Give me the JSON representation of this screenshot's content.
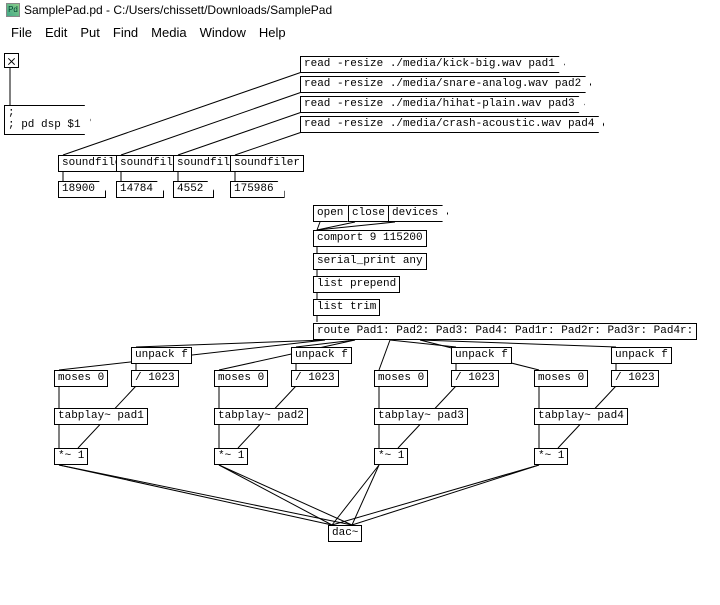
{
  "title": "SamplePad.pd  - C:/Users/chissett/Downloads/SamplePad",
  "menu": {
    "file": "File",
    "edit": "Edit",
    "put": "Put",
    "find": "Find",
    "media": "Media",
    "window": "Window",
    "help": "Help"
  },
  "dsp_msg": "; pd dsp $1",
  "reads": {
    "r1": "read -resize ./media/kick-big.wav pad1",
    "r2": "read -resize ./media/snare-analog.wav pad2",
    "r3": "read -resize ./media/hihat-plain.wav pad3",
    "r4": "read -resize ./media/crash-acoustic.wav pad4"
  },
  "soundfiler": "soundfiler",
  "counts": {
    "c1": "18900",
    "c2": "14784",
    "c3": "4552",
    "c4": "175986"
  },
  "btns": {
    "open": "open",
    "close": "close",
    "devices": "devices"
  },
  "comport": "comport 9 115200",
  "serial": "serial_print any",
  "listprepend": "list prepend",
  "listtrim": "list trim",
  "route": "route Pad1: Pad2: Pad3: Pad4: Pad1r: Pad2r: Pad3r: Pad4r:",
  "unpack": "unpack f",
  "moses": "moses 0",
  "div1023": "/ 1023",
  "tabplay": {
    "t1": "tabplay~ pad1",
    "t2": "tabplay~ pad2",
    "t3": "tabplay~ pad3",
    "t4": "tabplay~ pad4"
  },
  "mult": "*~ 1",
  "dac": "dac~"
}
